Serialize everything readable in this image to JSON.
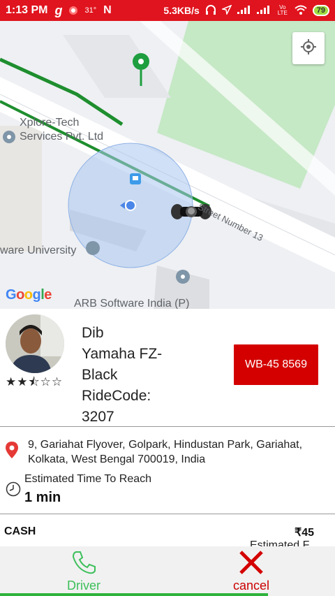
{
  "status_bar": {
    "time": "1:13 PM",
    "temp": "31°",
    "network_speed": "5.3KB/s",
    "battery": "79",
    "volte_label": "Vo LTE"
  },
  "map": {
    "poi_1_line1": "Xplore-Tech",
    "poi_1_line2": "Services Pvt. Ltd",
    "poi_2": "ware University",
    "poi_3": "ARB Software India (P)",
    "street": "Street Number 13",
    "google_logo": "Google"
  },
  "driver": {
    "name": "Dib",
    "vehicle_line1": "Yamaha FZ-",
    "vehicle_line2": "Black",
    "ride_code_label": "RideCode:",
    "ride_code": "3207",
    "plate": "WB-45 8569",
    "rating": 2.5
  },
  "trip": {
    "address": "9, Gariahat Flyover, Golpark, Hindustan Park, Gariahat, Kolkata, West Bengal 700019, India",
    "eta_label": "Estimated Time To Reach",
    "eta_value": "1 min",
    "payment_method": "CASH",
    "fare": "₹45",
    "fare_note": "Estimated F"
  },
  "actions": {
    "driver_label": "Driver",
    "cancel_label": "cancel"
  },
  "colors": {
    "brand_red": "#e0141e",
    "plate_red": "#d40000",
    "accent_green": "#2fb33c"
  }
}
